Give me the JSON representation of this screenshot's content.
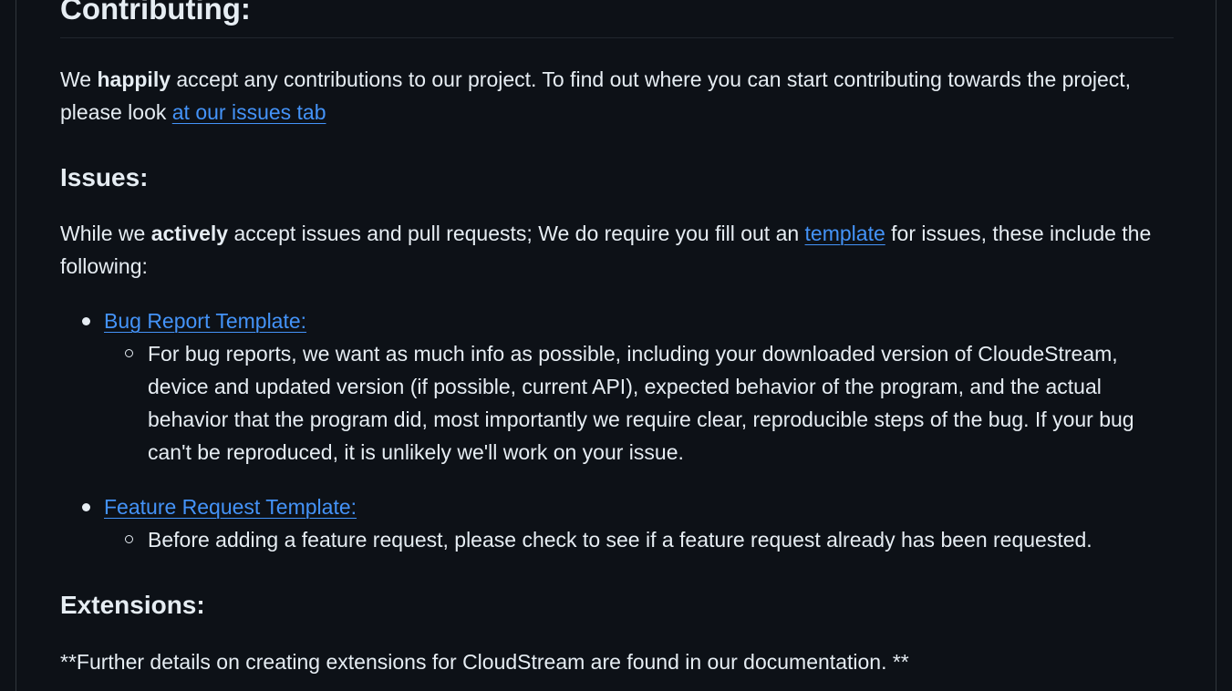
{
  "heading_contributing": "Contributing:",
  "intro": {
    "pre": "We ",
    "bold": "happily",
    "mid": " accept any contributions to our project. To find out where you can start contributing towards the project, please look ",
    "link": "at our issues tab"
  },
  "heading_issues": "Issues:",
  "issues_para": {
    "pre": "While we ",
    "bold": "actively",
    "mid": " accept issues and pull requests; We do require you fill out an ",
    "link": "template",
    "post": " for issues, these include the following:"
  },
  "templates": [
    {
      "link": "Bug Report Template:",
      "detail": "For bug reports, we want as much info as possible, including your downloaded version of CloudeStream, device and updated version (if possible, current API), expected behavior of the program, and the actual behavior that the program did, most importantly we require clear, reproducible steps of the bug. If your bug can't be reproduced, it is unlikely we'll work on your issue."
    },
    {
      "link": "Feature Request Template:",
      "detail": "Before adding a feature request, please check to see if a feature request already has been requested."
    }
  ],
  "heading_extensions": "Extensions:",
  "extensions_text": "**Further details on creating extensions for CloudStream are found in our documentation. **",
  "colors": {
    "background": "#0d1117",
    "text": "#e6edf3",
    "link": "#4493f8",
    "border": "#30363d"
  }
}
